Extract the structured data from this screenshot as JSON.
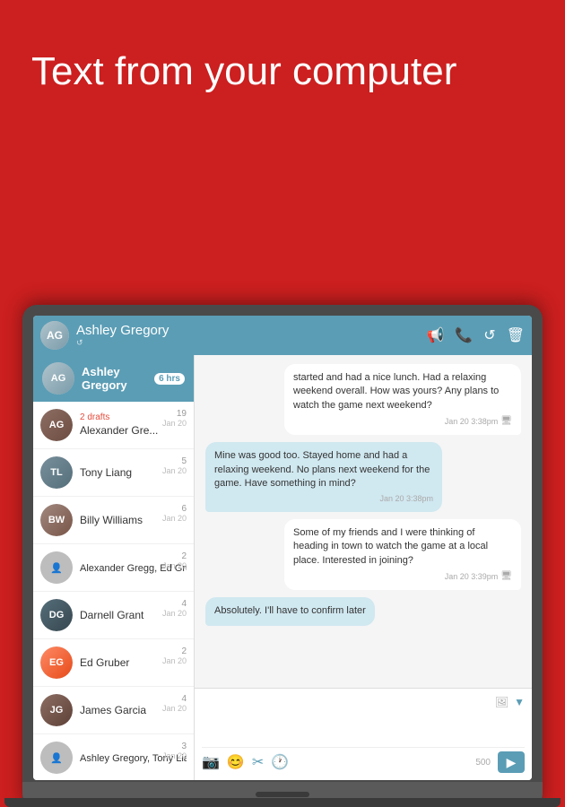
{
  "hero": {
    "text": "Text from your computer"
  },
  "app": {
    "header": {
      "name": "Ashley Gregory",
      "sub": "↺",
      "icons": [
        "📢",
        "📞",
        "↺",
        "🗑"
      ]
    },
    "sidebar": {
      "active_item": {
        "name": "Ashley Gregory",
        "badge": "6",
        "badge_label": "6 hrs"
      },
      "conversations": [
        {
          "name": "Alexander Gre...",
          "count": "2",
          "date": "Jan 20",
          "has_drafts": true,
          "drafts_label": "2 drafts",
          "count_val": "19",
          "avatar_color": "brown"
        },
        {
          "name": "Tony Liang",
          "count": "5",
          "date": "Jan 20",
          "has_drafts": false,
          "avatar_color": "dark"
        },
        {
          "name": "Billy Williams",
          "count": "6",
          "date": "Jan 20",
          "has_drafts": false,
          "avatar_color": "brown"
        },
        {
          "name": "Alexander Gregg, Ed Gruber",
          "count": "2",
          "date": "Jan 20",
          "has_drafts": false,
          "avatar_color": "gray"
        },
        {
          "name": "Darnell Grant",
          "count": "4",
          "date": "Jan 20",
          "has_drafts": false,
          "avatar_color": "dark"
        },
        {
          "name": "Ed Gruber",
          "count": "2",
          "date": "Jan 20",
          "has_drafts": false,
          "avatar_color": "orange"
        },
        {
          "name": "James Garcia",
          "count": "4",
          "date": "Jan 20",
          "has_drafts": false,
          "avatar_color": "brown"
        },
        {
          "name": "Ashley Gregory, Tony Liang",
          "count": "3",
          "date": "Jan 20",
          "has_drafts": false,
          "avatar_color": "gray"
        }
      ]
    },
    "chat": {
      "messages": [
        {
          "text": "started and had a nice lunch. Had a relaxing weekend overall. How was yours? Any plans to watch the game next weekend?",
          "time": "Jan 20 3:38pm",
          "type": "received",
          "has_check": true
        },
        {
          "text": "Mine was good too. Stayed home and had a relaxing weekend. No plans next weekend for the game. Have something in mind?",
          "time": "Jan 20 3:38pm",
          "type": "sent"
        },
        {
          "text": "Some of my friends and I were thinking of heading in town to watch the game at a local place. Interested in joining?",
          "time": "Jan 20 3:39pm",
          "type": "received",
          "has_check": true
        },
        {
          "text": "Absolutely. I'll have to confirm later",
          "time": "",
          "type": "sent_partial"
        }
      ],
      "input_placeholder": "",
      "char_count": "500",
      "toolbar_icons": [
        "📷",
        "😊",
        "✂",
        "🕐"
      ]
    }
  }
}
